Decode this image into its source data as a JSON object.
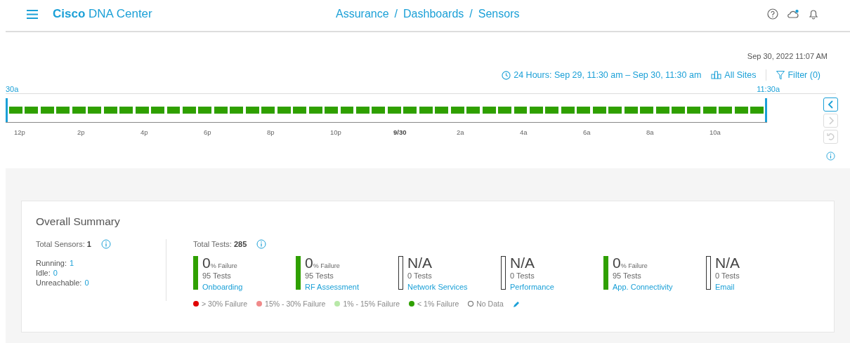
{
  "header": {
    "brand_bold": "Cisco",
    "brand": "DNA Center",
    "breadcrumb": [
      {
        "label": "Assurance"
      },
      {
        "separator": "/",
        "label": "Dashboards"
      },
      {
        "separator": "/",
        "label": "Sensors"
      }
    ]
  },
  "timestamp": "Sep 30, 2022 11:07 AM",
  "toolbar": {
    "time_range": "24 Hours: Sep 29, 11:30 am – Sep 30, 11:30 am",
    "sites": "All Sites",
    "filter": "Filter (0)"
  },
  "timeline": {
    "start_label": "30a",
    "end_label": "11:30a",
    "ticks": [
      {
        "label": "12p",
        "kind": "time"
      },
      {
        "label": "2p",
        "kind": "time"
      },
      {
        "label": "4p",
        "kind": "time"
      },
      {
        "label": "6p",
        "kind": "time"
      },
      {
        "label": "8p",
        "kind": "time"
      },
      {
        "label": "10p",
        "kind": "time"
      },
      {
        "label": "9/30",
        "kind": "date"
      },
      {
        "label": "2a",
        "kind": "time"
      },
      {
        "label": "4a",
        "kind": "time"
      },
      {
        "label": "6a",
        "kind": "time"
      },
      {
        "label": "8a",
        "kind": "time"
      },
      {
        "label": "10a",
        "kind": "time"
      }
    ],
    "nav": [
      {
        "kind": "prev",
        "disabled": false
      },
      {
        "kind": "next",
        "disabled": true
      },
      {
        "kind": "reset",
        "disabled": true
      }
    ]
  },
  "summary": {
    "title": "Overall Summary",
    "sensors_label": "Total Sensors:",
    "sensors_total": "1",
    "states": [
      {
        "label": "Running:",
        "value": "1"
      },
      {
        "label": "Idle:",
        "value": "0"
      },
      {
        "label": "Unreachable:",
        "value": "0"
      }
    ],
    "tests_label": "Total Tests:",
    "tests_total": "285",
    "metrics": [
      {
        "kind": "value",
        "value": "0",
        "unit": "% Failure",
        "tests": "95 Tests",
        "name": "Onboarding"
      },
      {
        "kind": "value",
        "value": "0",
        "unit": "% Failure",
        "tests": "95 Tests",
        "name": "RF Assessment"
      },
      {
        "kind": "na",
        "value": "N/A",
        "tests": "0 Tests",
        "name": "Network Services"
      },
      {
        "kind": "na",
        "value": "N/A",
        "tests": "0 Tests",
        "name": "Performance"
      },
      {
        "kind": "value",
        "value": "0",
        "unit": "% Failure",
        "tests": "95 Tests",
        "name": "App. Connectivity"
      },
      {
        "kind": "na",
        "value": "N/A",
        "tests": "0 Tests",
        "name": "Email"
      }
    ],
    "legend": [
      {
        "label": "> 30% Failure",
        "color": "#e00000"
      },
      {
        "label": "15% - 30% Failure",
        "color": "#f08a8a"
      },
      {
        "label": "1% - 15% Failure",
        "color": "#b8e8a8"
      },
      {
        "label": "< 1% Failure",
        "color": "#2fa000"
      },
      {
        "label": "No Data",
        "color": "#ffffff",
        "kind": "outline"
      }
    ]
  }
}
